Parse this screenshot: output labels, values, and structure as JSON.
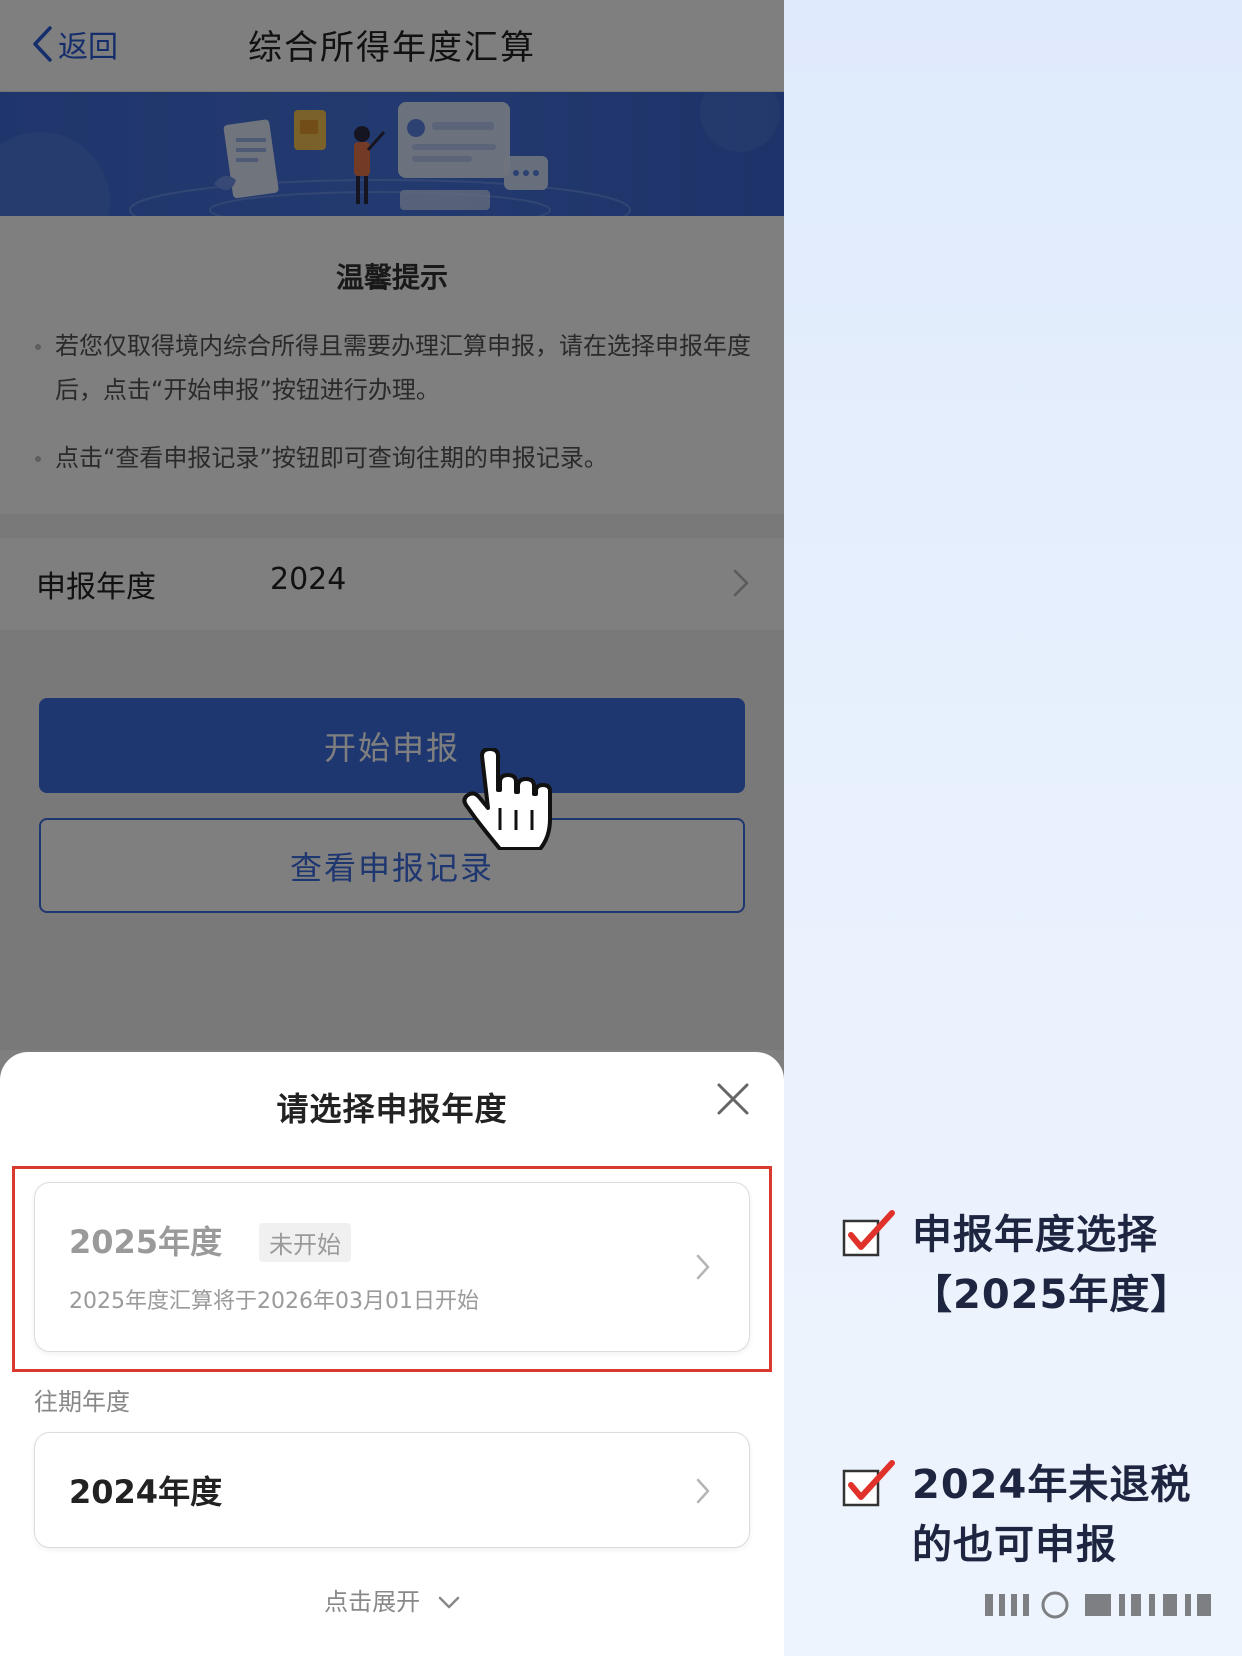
{
  "header": {
    "back_label": "返回",
    "title": "综合所得年度汇算"
  },
  "tips": {
    "title": "温馨提示",
    "items": [
      "若您仅取得境内综合所得且需要办理汇算申报，请在选择申报年度后，点击“开始申报”按钮进行办理。",
      "点击“查看申报记录”按钮即可查询往期的申报记录。"
    ]
  },
  "filing_year": {
    "label": "申报年度",
    "value": "2024"
  },
  "buttons": {
    "start": "开始申报",
    "records": "查看申报记录"
  },
  "sheet": {
    "title": "请选择申报年度",
    "current": {
      "year": "2025年度",
      "badge": "未开始",
      "subtitle": "2025年度汇算将于2026年03月01日开始"
    },
    "past_label": "往期年度",
    "past": [
      {
        "year": "2024年度"
      }
    ],
    "expand": "点击展开"
  },
  "annotations": [
    "申报年度选择【2025年度】",
    "2024年未退税的也可申报"
  ],
  "colors": {
    "primary": "#3f6ee0",
    "highlight_border": "#d93a30",
    "check_mark": "#e0322a"
  },
  "icons": [
    "chevron-left-icon",
    "chevron-right-icon",
    "close-icon",
    "pointer-hand-icon",
    "checkbox-checked-icon",
    "chevron-down-icon"
  ]
}
